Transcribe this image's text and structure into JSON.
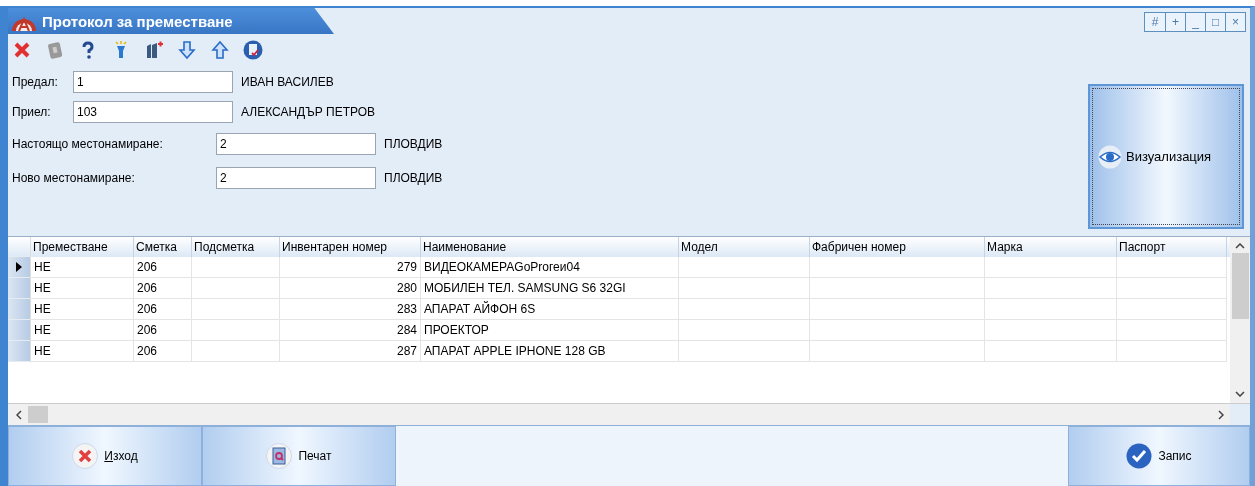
{
  "window": {
    "title": "Протокол за преместване",
    "controls": [
      "#",
      "+",
      "_",
      "□",
      "×"
    ]
  },
  "toolbar": [
    {
      "kind": "delete"
    },
    {
      "kind": "help-book"
    },
    {
      "kind": "question"
    },
    {
      "kind": "flashlight"
    },
    {
      "kind": "folders"
    },
    {
      "kind": "down"
    },
    {
      "kind": "up"
    },
    {
      "kind": "document"
    }
  ],
  "form": [
    {
      "label": "Предал:",
      "value": "1",
      "name": "ИВАН ВАСИЛЕВ"
    },
    {
      "label": "Приел:",
      "value": "103",
      "name": "АЛЕКСАНДЪР ПЕТРОВ"
    },
    {
      "label": "Настоящо местонамиране:",
      "value": "2",
      "name": "ПЛОВДИВ"
    },
    {
      "label": "Ново местонамиране:",
      "value": "2",
      "name": "ПЛОВДИВ"
    }
  ],
  "visualize_button": {
    "label": "Визуализация"
  },
  "table": {
    "columns": [
      "Преместване",
      "Сметка",
      "Подсметка",
      "Инвентарен номер",
      "Наименование",
      "Модел",
      "Фабричен номер",
      "Марка",
      "Паспорт"
    ],
    "rows": [
      {
        "selected": true,
        "cells": [
          "НЕ",
          "206",
          "",
          "279",
          "ВИДЕОКАМЕРАGoProгеи04",
          "",
          "",
          "",
          ""
        ]
      },
      {
        "selected": false,
        "cells": [
          "НЕ",
          "206",
          "",
          "280",
          "МОБИЛЕН ТЕЛ. SAMSUNG S6 32GI",
          "",
          "",
          "",
          ""
        ]
      },
      {
        "selected": false,
        "cells": [
          "НЕ",
          "206",
          "",
          "283",
          "АПАРАТ АЙФОН 6S",
          "",
          "",
          "",
          ""
        ]
      },
      {
        "selected": false,
        "cells": [
          "НЕ",
          "206",
          "",
          "284",
          "ПРОЕКТОР",
          "",
          "",
          "",
          ""
        ]
      },
      {
        "selected": false,
        "cells": [
          "НЕ",
          "206",
          "",
          "287",
          "АПАРАТ APPLE IPHONE 128 GB",
          "",
          "",
          "",
          ""
        ]
      }
    ]
  },
  "buttons": [
    {
      "kind": "exit",
      "label": "Изход",
      "mnemonic": true
    },
    {
      "kind": "print",
      "label": "Печат",
      "mnemonic": false
    },
    {
      "kind": "save",
      "label": "Запис",
      "mnemonic": false
    }
  ]
}
